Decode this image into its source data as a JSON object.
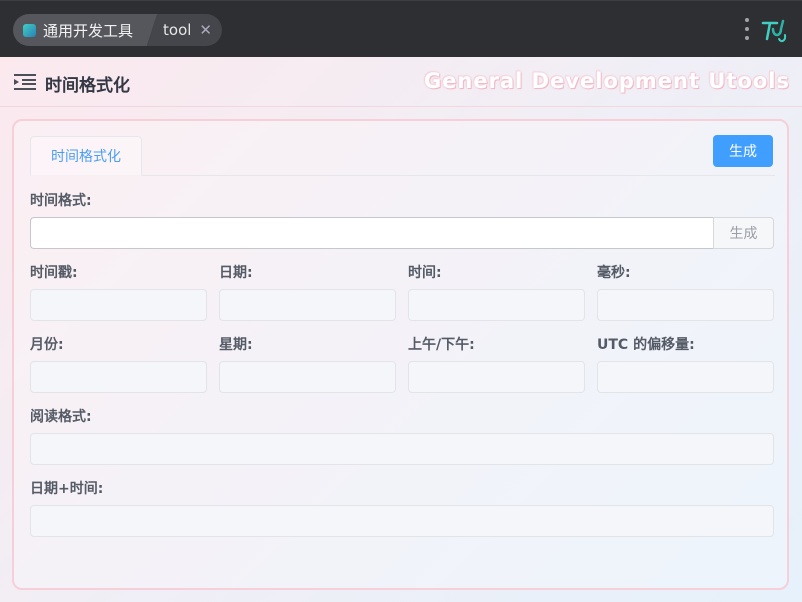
{
  "titlebar": {
    "app_name": "通用开发工具",
    "tab_name": "tool",
    "close_symbol": "✕"
  },
  "header": {
    "title": "时间格式化",
    "brand": "General Development Utools"
  },
  "card": {
    "tab_label": "时间格式化",
    "generate_label": "生成",
    "format_label": "时间格式:",
    "format_value": "",
    "format_generate_label": "生成",
    "fields_row1": [
      "时间戳:",
      "日期:",
      "时间:",
      "毫秒:"
    ],
    "fields_row2": [
      "月份:",
      "星期:",
      "上午/下午:",
      "UTC 的偏移量:"
    ],
    "reading_label": "阅读格式:",
    "datetime_label": "日期+时间:"
  },
  "colors": {
    "accent": "#409eff",
    "titlebar_bg": "#2e2f33",
    "card_border": "#f6cfd8"
  },
  "icons": {
    "app": "app-logo-icon",
    "menu": "menu-dots-icon",
    "brand": "brand-logo-icon",
    "sidebar_toggle": "menu-fold-icon"
  }
}
